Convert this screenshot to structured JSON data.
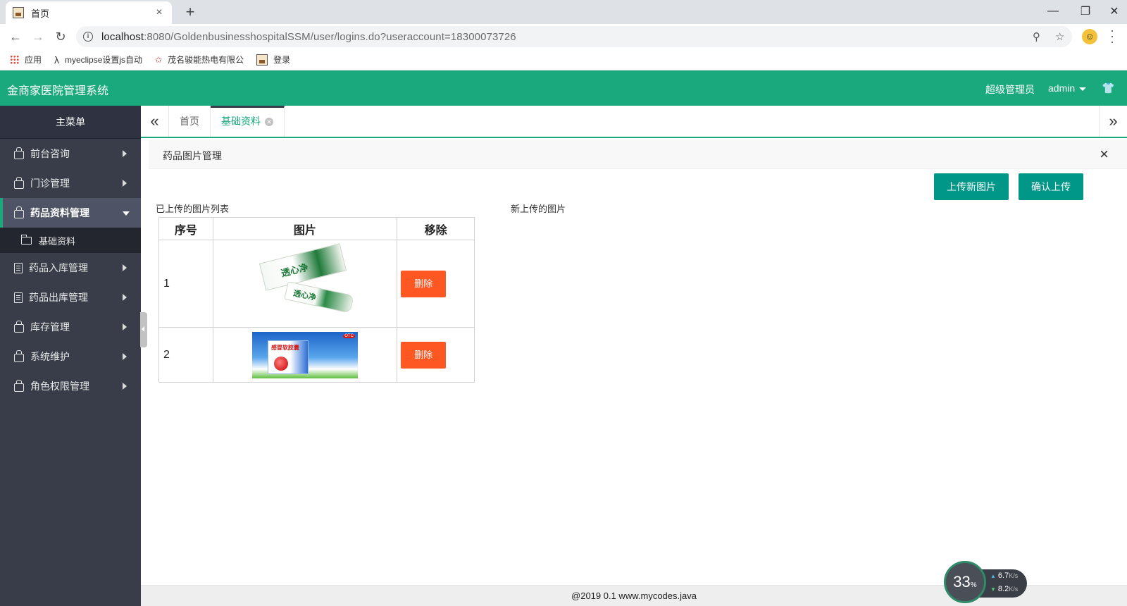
{
  "browser": {
    "tab_title": "首页",
    "tab_close": "×",
    "new_tab": "+",
    "url_host": "localhost",
    "url_rest": ":8080/GoldenbusinesshospitalSSM/user/logins.do?useraccount=18300073726",
    "bookmarks": [
      "应用",
      "myeclipse设置js自动",
      "茂名骏能热电有限公",
      "登录"
    ]
  },
  "header": {
    "title": "金商家医院管理系统",
    "role": "超级管理员",
    "user": "admin"
  },
  "sidebar": {
    "title": "主菜单",
    "items": [
      {
        "label": "前台咨询",
        "icon": "bag-icon"
      },
      {
        "label": "门诊管理",
        "icon": "bag-icon"
      },
      {
        "label": "药品资料管理",
        "icon": "bag-icon",
        "active": true
      },
      {
        "label": "基础资料",
        "icon": "folder-icon",
        "sub": true
      },
      {
        "label": "药品入库管理",
        "icon": "document-icon"
      },
      {
        "label": "药品出库管理",
        "icon": "document-icon"
      },
      {
        "label": "库存管理",
        "icon": "bag-icon"
      },
      {
        "label": "系统维护",
        "icon": "bag-icon"
      },
      {
        "label": "角色权限管理",
        "icon": "bag-icon"
      }
    ]
  },
  "tabs": [
    {
      "label": "首页"
    },
    {
      "label": "基础资料",
      "active": true
    }
  ],
  "panel": {
    "title": "药品图片管理",
    "upload_new": "上传新图片",
    "confirm_upload": "确认上传",
    "uploaded_label": "已上传的图片列表",
    "new_label": "新上传的图片"
  },
  "table": {
    "headers": [
      "序号",
      "图片",
      "移除"
    ],
    "rows": [
      {
        "num": "1",
        "image": "透心净",
        "action": "删除"
      },
      {
        "num": "2",
        "image": "感冒软胶囊",
        "action": "删除"
      }
    ]
  },
  "footer": {
    "text": "@2019 0.1 www.mycodes.java"
  },
  "network": {
    "percent": "33",
    "percent_unit": "%",
    "up": "6.7",
    "down": "8.2",
    "unit": "K/s"
  },
  "colors": {
    "brand": "#1aa97d",
    "sidebar": "#393d49",
    "primary_button": "#009688",
    "danger_button": "#ff5722"
  }
}
